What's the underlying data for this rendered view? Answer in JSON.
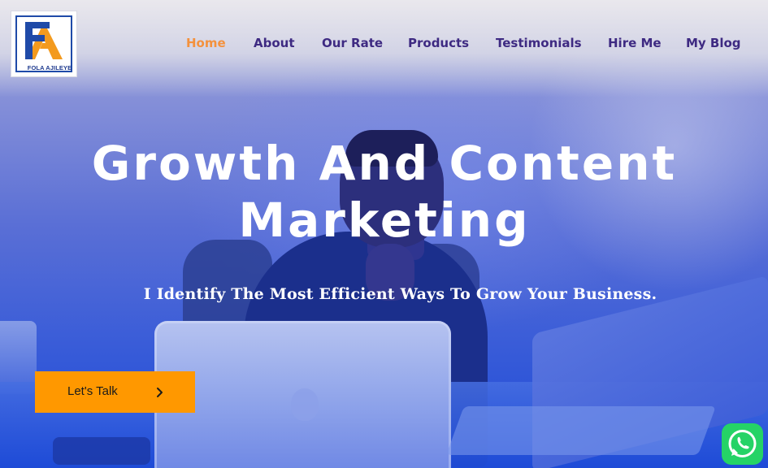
{
  "brand": {
    "logo_text": "FOLA AJILEYE",
    "colors": {
      "logo_blue": "#1f4aa8",
      "logo_orange": "#f39a1e",
      "nav_text": "#3e2a82",
      "nav_active": "#f4913d",
      "cta_background": "#ff9800",
      "whatsapp_green": "#25d366"
    }
  },
  "nav": {
    "items": [
      {
        "label": "Home",
        "active": true
      },
      {
        "label": "About",
        "active": false
      },
      {
        "label": "Our Rate",
        "active": false
      },
      {
        "label": "Products",
        "active": false
      },
      {
        "label": "Testimonials",
        "active": false
      },
      {
        "label": "Hire Me",
        "active": false
      },
      {
        "label": "My Blog",
        "active": false
      }
    ]
  },
  "hero": {
    "title_line1": "Growth And Content",
    "title_line2": "Marketing",
    "subtitle": "I Identify The Most Efficient Ways To Grow Your Business.",
    "cta_label": "Let's Talk",
    "cta_icon": "chevron-right-icon"
  },
  "floating": {
    "whatsapp_icon": "whatsapp-icon"
  }
}
